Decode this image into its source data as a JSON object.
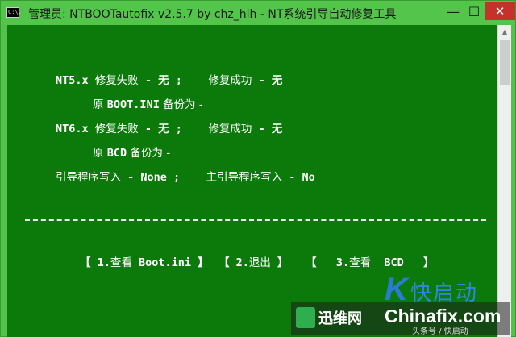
{
  "window": {
    "title": "管理员:  NTBOOTautofix v2.5.7 by chz_hlh - NT系统引导自动修复工具",
    "icon_label": "C:\\.",
    "minimize_glyph": "—",
    "maximize_glyph": "☐",
    "close_glyph": "✕"
  },
  "console": {
    "nt5_label": "NT5.x",
    "nt5_fail": "修复失败",
    "nt5_fail_value": " - 无 ;",
    "nt5_success": "修复成功",
    "nt5_success_value": " - 无",
    "bootini_prefix": "原 ",
    "bootini_file": "BOOT.INI",
    "bootini_backup": " 备份为 -",
    "nt6_label": "NT6.x",
    "nt6_fail": "修复失败",
    "nt6_fail_value": " - 无 ;",
    "nt6_success": "修复成功",
    "nt6_success_value": " - 无",
    "bcd_prefix": "原 ",
    "bcd_file": "BCD",
    "bcd_backup": " 备份为 -",
    "bootloader_label": "引导程序写入",
    "bootloader_value": " - None ;",
    "main_bootloader_label": "主引导程序写入",
    "main_bootloader_value": " - No"
  },
  "menu": {
    "item1_open": "【 1.",
    "item1_label": "查看",
    "item1_target": " Boot.ini 】",
    "item2_open": "【 2.",
    "item2_label": "退出",
    "item2_close": " 】",
    "item3_open": "【   3.",
    "item3_label": "查看",
    "item3_target": "  BCD   】"
  },
  "watermark": {
    "k_mark": "K",
    "kuaiqidong": "快启动",
    "xunwei": "迅维网",
    "chinafix": "Chinafix.com",
    "sub": "头条号 / 快启动"
  },
  "colors": {
    "console_bg": "#0b7a0b",
    "titlebar_bg": "#54c54b",
    "close_bg": "#c7312b",
    "text": "#ffffff"
  }
}
